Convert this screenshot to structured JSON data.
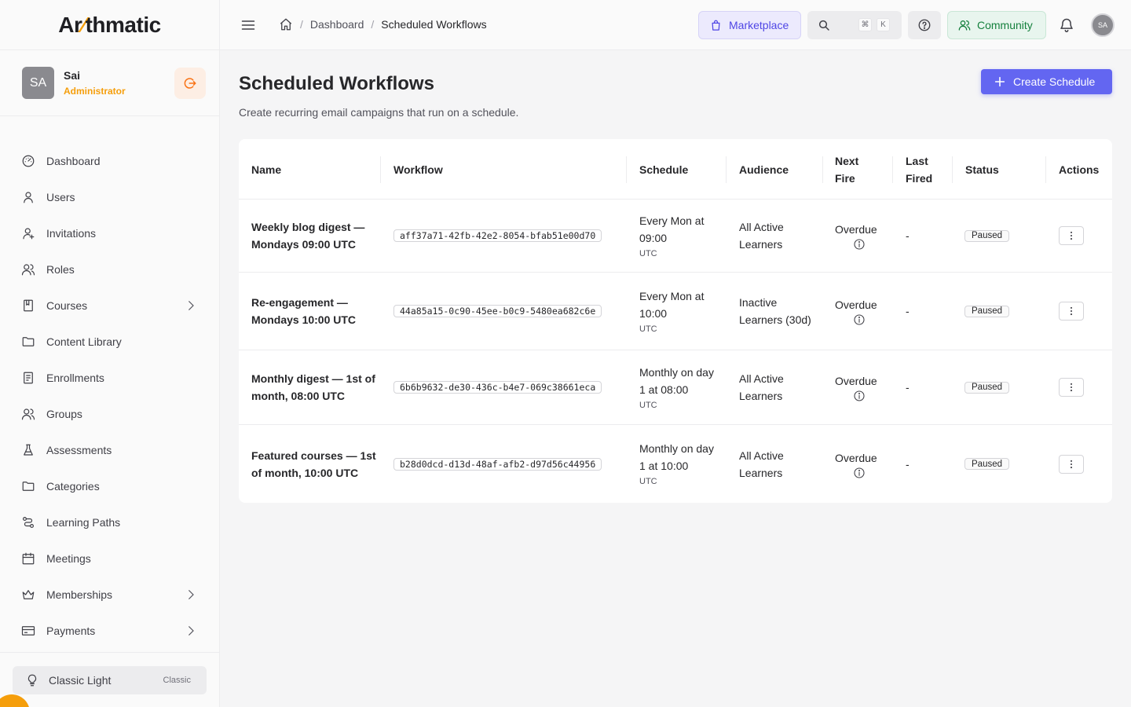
{
  "brand": {
    "logo_pre": "Ar",
    "logo_accent": "⁄",
    "logo_post": "thmatic",
    "accent": "#f59e0b"
  },
  "profile": {
    "initials": "SA",
    "name": "Sai",
    "role": "Administrator"
  },
  "sidebar": {
    "items": [
      {
        "label": "Dashboard",
        "icon": "gauge-icon"
      },
      {
        "label": "Users",
        "icon": "user-icon"
      },
      {
        "label": "Invitations",
        "icon": "user-plus-icon"
      },
      {
        "label": "Roles",
        "icon": "users-icon"
      },
      {
        "label": "Courses",
        "icon": "book-icon",
        "expandable": true
      },
      {
        "label": "Content Library",
        "icon": "folder-icon"
      },
      {
        "label": "Enrollments",
        "icon": "clipboard-icon"
      },
      {
        "label": "Groups",
        "icon": "users-icon"
      },
      {
        "label": "Assessments",
        "icon": "flask-icon"
      },
      {
        "label": "Categories",
        "icon": "folder-icon"
      },
      {
        "label": "Learning Paths",
        "icon": "route-icon"
      },
      {
        "label": "Meetings",
        "icon": "calendar-icon"
      },
      {
        "label": "Memberships",
        "icon": "crown-icon",
        "expandable": true
      },
      {
        "label": "Payments",
        "icon": "credit-card-icon",
        "expandable": true
      }
    ],
    "theme": {
      "label": "Classic Light",
      "tag": "Classic"
    }
  },
  "header": {
    "breadcrumb": {
      "parent": "Dashboard",
      "current": "Scheduled Workflows",
      "sep": "/"
    },
    "marketplace_label": "Marketplace",
    "search_kbd": [
      "⌘",
      "K"
    ],
    "community_label": "Community",
    "avatar_initials": "SA"
  },
  "main": {
    "title": "Scheduled Workflows",
    "subtitle": "Create recurring email campaigns that run on a schedule.",
    "create_label": "Create Schedule",
    "accent": "#6366f1"
  },
  "table": {
    "columns": {
      "name": "Name",
      "workflow": "Workflow",
      "schedule": "Schedule",
      "audience": "Audience",
      "next_fire": "Next Fire",
      "last_fired": "Last Fired",
      "status": "Status",
      "actions": "Actions"
    },
    "rows": [
      {
        "name": "Weekly blog digest — Mondays 09:00 UTC",
        "workflow": "aff37a71-42fb-42e2-8054-bfab51e00d70",
        "schedule": "Every Mon at 09:00",
        "tz": "UTC",
        "audience": "All Active Learners",
        "next_fire": "Overdue",
        "last_fired": "-",
        "status": "Paused"
      },
      {
        "name": "Re-engagement — Mondays 10:00 UTC",
        "workflow": "44a85a15-0c90-45ee-b0c9-5480ea682c6e",
        "schedule": "Every Mon at 10:00",
        "tz": "UTC",
        "audience": "Inactive Learners (30d)",
        "next_fire": "Overdue",
        "last_fired": "-",
        "status": "Paused"
      },
      {
        "name": "Monthly digest — 1st of month, 08:00 UTC",
        "workflow": "6b6b9632-de30-436c-b4e7-069c38661eca",
        "schedule": "Monthly on day 1 at 08:00",
        "tz": "UTC",
        "audience": "All Active Learners",
        "next_fire": "Overdue",
        "last_fired": "-",
        "status": "Paused"
      },
      {
        "name": "Featured courses — 1st of month, 10:00 UTC",
        "workflow": "b28d0dcd-d13d-48af-afb2-d97d56c44956",
        "schedule": "Monthly on day 1 at 10:00",
        "tz": "UTC",
        "audience": "All Active Learners",
        "next_fire": "Overdue",
        "last_fired": "-",
        "status": "Paused"
      }
    ]
  }
}
